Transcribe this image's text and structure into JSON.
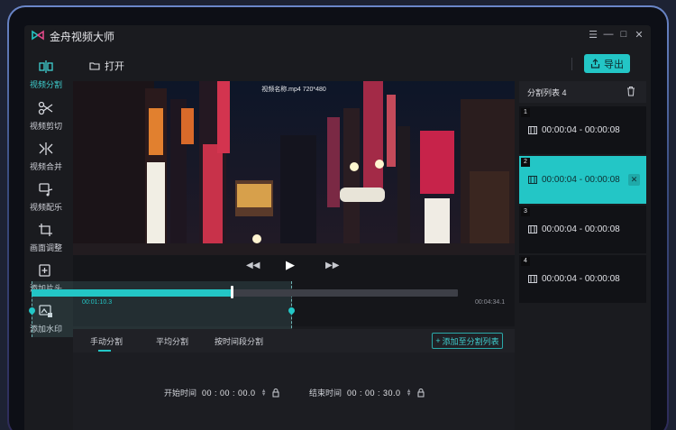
{
  "app": {
    "title": "金舟视频大师"
  },
  "window_controls": {
    "menu": "☰",
    "minimize": "—",
    "maximize": "□",
    "close": "✕"
  },
  "sidebar": {
    "items": [
      {
        "label": "视频分割",
        "icon": "split-icon",
        "active": true
      },
      {
        "label": "视频剪切",
        "icon": "scissors-icon",
        "active": false
      },
      {
        "label": "视频合并",
        "icon": "merge-icon",
        "active": false
      },
      {
        "label": "视频配乐",
        "icon": "music-icon",
        "active": false
      },
      {
        "label": "画面调整",
        "icon": "crop-icon",
        "active": false
      },
      {
        "label": "添加片头",
        "icon": "add-intro-icon",
        "active": false
      },
      {
        "label": "添加水印",
        "icon": "watermark-icon",
        "active": false
      }
    ]
  },
  "toolbar": {
    "open_label": "打开",
    "export_label": "导出"
  },
  "player": {
    "video_title": "视频名称.mp4  720*480",
    "rewind": "◀◀",
    "play": "▶",
    "forward": "▶▶",
    "current_time": "00:01:10.3",
    "total_time": "00:04:34.1",
    "progress_fraction": 0.47,
    "selection_start_fraction": 0.0,
    "selection_end_fraction": 0.61
  },
  "split_tabs": {
    "items": [
      {
        "label": "手动分割",
        "active": true
      },
      {
        "label": "平均分割",
        "active": false
      },
      {
        "label": "按时间段分割",
        "active": false
      }
    ],
    "add_button": "添加至分割列表"
  },
  "time_fields": {
    "start_label": "开始时间",
    "start_value": "00 : 00 : 00.0",
    "end_label": "结束时间",
    "end_value": "00 : 00 : 30.0"
  },
  "segment_list": {
    "title": "分割列表 4",
    "items": [
      {
        "index": "1",
        "range": "00:00:04 - 00:00:08",
        "selected": false
      },
      {
        "index": "2",
        "range": "00:00:04 - 00:00:08",
        "selected": true
      },
      {
        "index": "3",
        "range": "00:00:04 - 00:00:08",
        "selected": false
      },
      {
        "index": "4",
        "range": "00:00:04 - 00:00:08",
        "selected": false
      }
    ],
    "remove_symbol": "✕"
  },
  "colors": {
    "accent": "#23c6c6",
    "background": "#1a1b1f",
    "panel": "#202126"
  }
}
